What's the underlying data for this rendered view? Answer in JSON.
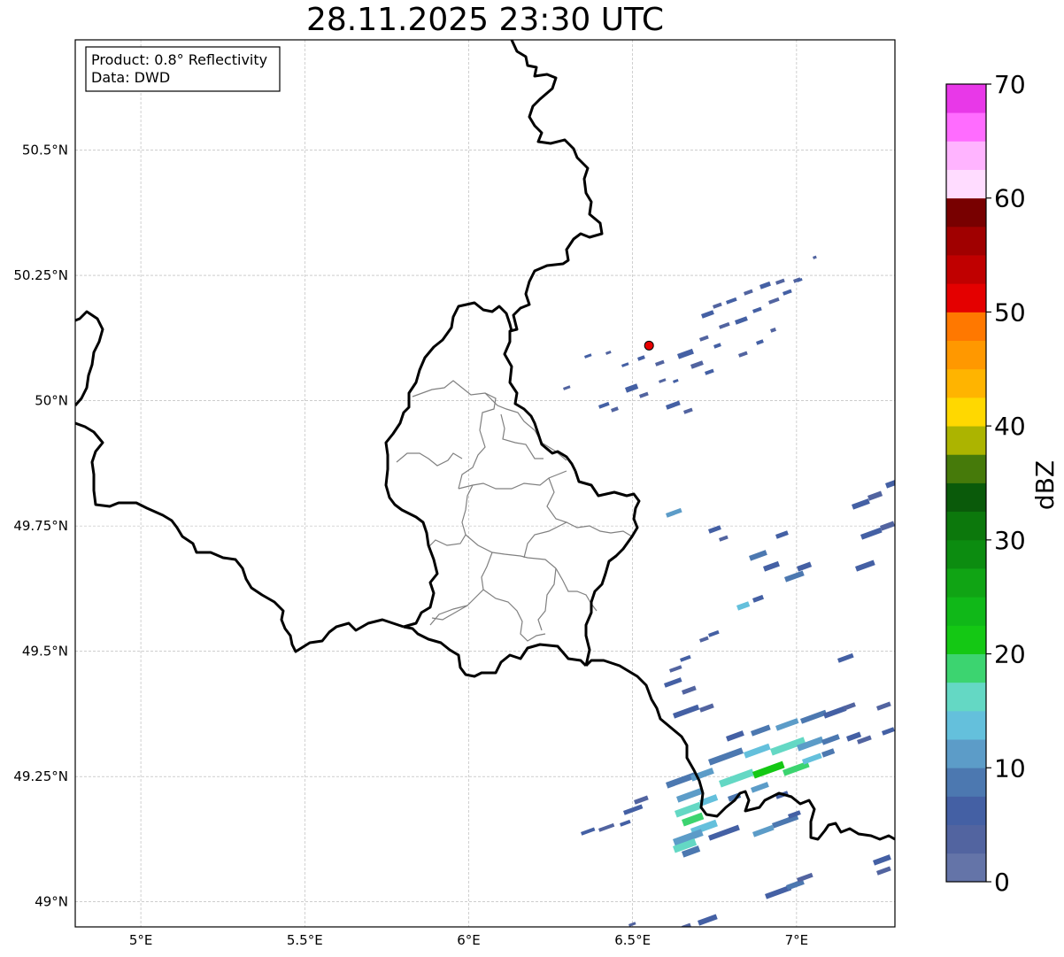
{
  "title": "28.11.2025 23:30 UTC",
  "info_box": {
    "line1": "Product: 0.8° Reflectivity",
    "line2": "Data: DWD"
  },
  "map": {
    "lon_range": [
      4.8,
      7.3
    ],
    "lat_range": [
      48.95,
      50.72
    ],
    "x_ticks": [
      {
        "value": 5.0,
        "label": "5°E"
      },
      {
        "value": 5.5,
        "label": "5.5°E"
      },
      {
        "value": 6.0,
        "label": "6°E"
      },
      {
        "value": 6.5,
        "label": "6.5°E"
      },
      {
        "value": 7.0,
        "label": "7°E"
      }
    ],
    "y_ticks": [
      {
        "value": 49.0,
        "label": "49°N"
      },
      {
        "value": 49.25,
        "label": "49.25°N"
      },
      {
        "value": 49.5,
        "label": "49.5°N"
      },
      {
        "value": 49.75,
        "label": "49.75°N"
      },
      {
        "value": 50.0,
        "label": "50°N"
      },
      {
        "value": 50.25,
        "label": "50.25°N"
      },
      {
        "value": 50.5,
        "label": "50.5°N"
      }
    ],
    "gridlines": true,
    "radar_site": {
      "lon": 6.55,
      "lat": 50.11,
      "color": "#e80000"
    },
    "national_border_color": "#000000",
    "admin_border_color": "#808080"
  },
  "colorbar": {
    "label": "dBZ",
    "min": 0,
    "max": 70,
    "tick_labels": [
      "0",
      "10",
      "20",
      "30",
      "40",
      "50",
      "60",
      "70"
    ],
    "colors": [
      "#6474a8",
      "#5264a0",
      "#4460a4",
      "#4c78b0",
      "#5c9cc8",
      "#64c0dc",
      "#64d8c4",
      "#3cd470",
      "#14c814",
      "#10b818",
      "#10a414",
      "#0c8c10",
      "#0c780c",
      "#0a5a0a",
      "#467a0a",
      "#acb400",
      "#ffd800",
      "#ffb400",
      "#ff9800",
      "#ff7800",
      "#e40000",
      "#c00000",
      "#a00000",
      "#780000",
      "#ffdcff",
      "#ffb4ff",
      "#ff6cff",
      "#e838e8"
    ]
  }
}
